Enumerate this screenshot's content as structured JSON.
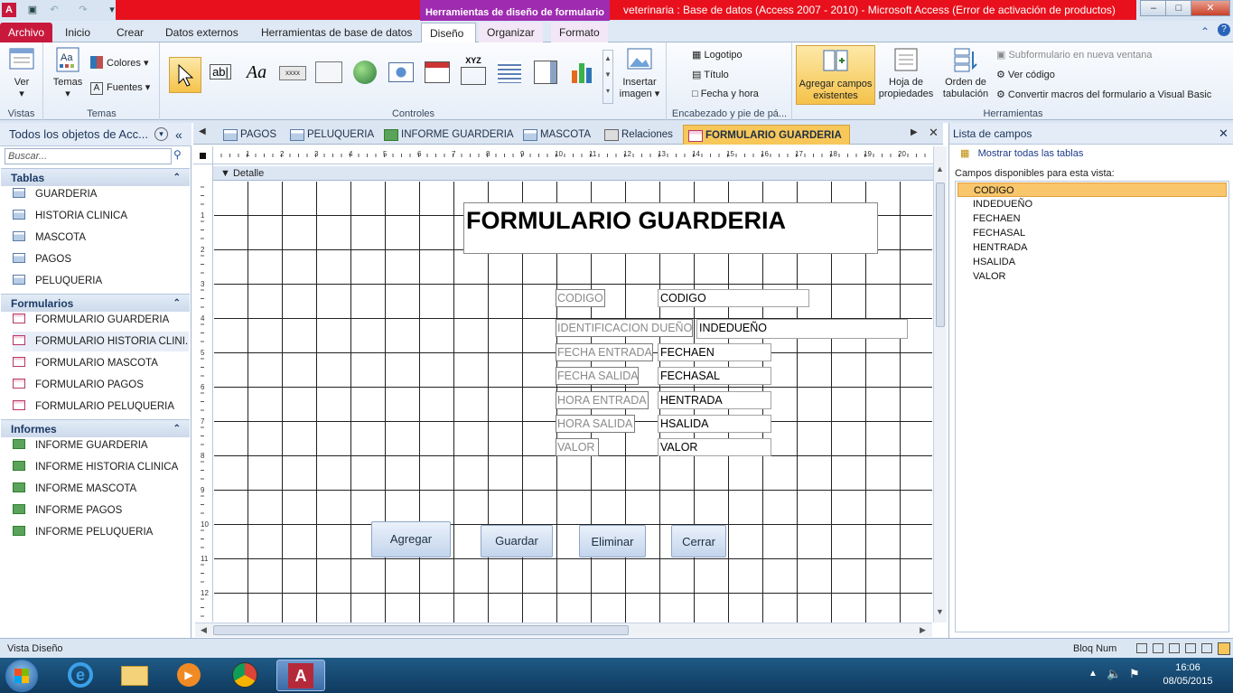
{
  "window": {
    "context_tab_title": "Herramientas de diseño de formulario",
    "title": "veterinaria : Base de datos (Access 2007 - 2010)  -  Microsoft Access (Error de activación de productos)"
  },
  "ribbon_tabs": [
    "Archivo",
    "Inicio",
    "Crear",
    "Datos externos",
    "Herramientas de base de datos",
    "Diseño",
    "Organizar",
    "Formato"
  ],
  "ribbon": {
    "vistas": {
      "ver": "Ver",
      "group": "Vistas"
    },
    "temas": {
      "temas": "Temas",
      "colores": "Colores",
      "fuentes": "Fuentes",
      "group": "Temas"
    },
    "controles": {
      "group": "Controles",
      "insertar_imagen": "Insertar imagen",
      "xyz": "XYZ",
      "aa": "Aa",
      "ab": "ab|",
      "xxxx": "xxxx"
    },
    "encabezado": {
      "logotipo": "Logotipo",
      "titulo": "Título",
      "fecha": "Fecha y hora",
      "group": "Encabezado y pie de pá..."
    },
    "herramientas": {
      "agregar": "Agregar campos existentes",
      "hoja": "Hoja de propiedades",
      "orden": "Orden de tabulación",
      "subformulario": "Subformulario en nueva ventana",
      "ver_codigo": "Ver código",
      "convertir": "Convertir macros del formulario a Visual Basic",
      "group": "Herramientas"
    }
  },
  "nav": {
    "header": "Todos los objetos de Acc...",
    "search_placeholder": "Buscar...",
    "sections": [
      {
        "title": "Tablas",
        "items": [
          "GUARDERIA",
          "HISTORIA CLINICA",
          "MASCOTA",
          "PAGOS",
          "PELUQUERIA"
        ]
      },
      {
        "title": "Formularios",
        "items": [
          "FORMULARIO GUARDERIA",
          "FORMULARIO HISTORIA CLINI...",
          "FORMULARIO MASCOTA",
          "FORMULARIO PAGOS",
          "FORMULARIO PELUQUERIA"
        ]
      },
      {
        "title": "Informes",
        "items": [
          "INFORME GUARDERIA",
          "INFORME HISTORIA CLINICA",
          "INFORME MASCOTA",
          "INFORME PAGOS",
          "INFORME PELUQUERIA"
        ]
      }
    ]
  },
  "doc_tabs": [
    "PAGOS",
    "PELUQUERIA",
    "INFORME GUARDERIA",
    "MASCOTA",
    "Relaciones",
    "FORMULARIO GUARDERIA"
  ],
  "designer": {
    "section": "Detalle",
    "ruler_h": [
      "1",
      "2",
      "3",
      "4",
      "5",
      "6",
      "7",
      "8",
      "9",
      "10",
      "11",
      "12",
      "13",
      "14",
      "15",
      "16",
      "17",
      "18",
      "19",
      "20"
    ],
    "ruler_v": [
      "1",
      "2",
      "3",
      "4",
      "5",
      "6",
      "7",
      "8",
      "9",
      "10",
      "11",
      "12"
    ],
    "form_title": "FORMULARIO GUARDERIA",
    "fields": [
      {
        "label": "CODIGO",
        "control": "CODIGO"
      },
      {
        "label": "IDENTIFICACION DUEÑO",
        "control": "INDEDUEÑO"
      },
      {
        "label": "FECHA ENTRADA",
        "control": "FECHAEN"
      },
      {
        "label": "FECHA SALIDA",
        "control": "FECHASAL"
      },
      {
        "label": "HORA ENTRADA",
        "control": "HENTRADA"
      },
      {
        "label": "HORA SALIDA",
        "control": "HSALIDA"
      },
      {
        "label": "VALOR",
        "control": "VALOR"
      }
    ],
    "buttons": [
      "Agregar",
      "Guardar",
      "Eliminar",
      "Cerrar"
    ]
  },
  "field_list": {
    "header": "Lista de campos",
    "show_all": "Mostrar todas las tablas",
    "available": "Campos disponibles para esta vista:",
    "fields": [
      "CODIGO",
      "INDEDUEÑO",
      "FECHAEN",
      "FECHASAL",
      "HENTRADA",
      "HSALIDA",
      "VALOR"
    ]
  },
  "status": {
    "left": "Vista Diseño",
    "right": "Bloq Num"
  },
  "taskbar": {
    "time": "16:06",
    "date": "08/05/2015"
  }
}
